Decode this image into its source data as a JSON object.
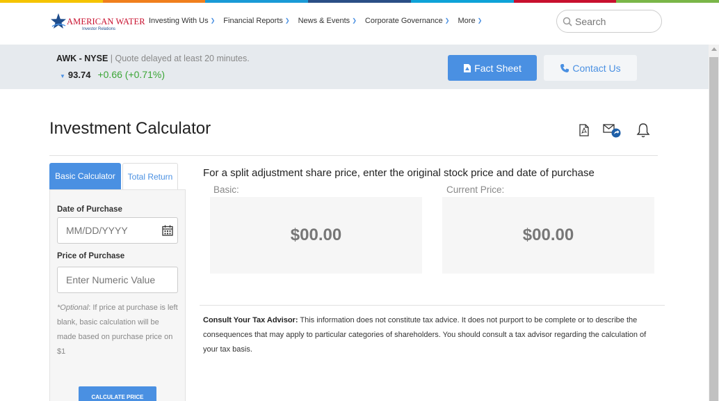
{
  "brand": {
    "name": "AMERICAN WATER",
    "subtitle": "Investor Relations",
    "color_bar": [
      "#f5c400",
      "#f07f1d",
      "#1a9ad6",
      "#2b4f86",
      "#0ea3d8",
      "#c8102e",
      "#7ab648"
    ]
  },
  "nav": {
    "items": [
      {
        "label": "Investing With Us"
      },
      {
        "label": "Financial Reports"
      },
      {
        "label": "News & Events"
      },
      {
        "label": "Corporate Governance"
      },
      {
        "label": "More"
      }
    ],
    "search_placeholder": "Search"
  },
  "quote": {
    "ticker": "AWK - NYSE",
    "delay_text": " | Quote delayed at least 20 minutes.",
    "price": "93.74",
    "change": "+0.66 (+0.71%)",
    "change_color": "#3aa535"
  },
  "actions": {
    "fact_sheet": "Fact Sheet",
    "contact_us": "Contact Us"
  },
  "page": {
    "title": "Investment Calculator",
    "tools": [
      "pdf-icon",
      "email-share-icon",
      "bell-icon"
    ]
  },
  "tabs": [
    {
      "label": "Basic Calculator",
      "active": true
    },
    {
      "label": "Total Return",
      "active": false
    }
  ],
  "form": {
    "date_label": "Date of Purchase",
    "date_placeholder": "MM/DD/YYYY",
    "price_label": "Price of Purchase",
    "price_placeholder": "Enter Numeric Value",
    "note_optional": "*Optional",
    "note_text": ": If price at purchase is left blank, basic calculation will be made based on purchase price on $1",
    "calculate_label": "CALCULATE PRICE"
  },
  "results": {
    "instruction": "For a split adjustment share price, enter the original stock price and date of purchase",
    "basic_label": "Basic:",
    "basic_value": "$00.00",
    "current_label": "Current Price:",
    "current_value": "$00.00"
  },
  "disclaimer": {
    "heading": "Consult Your Tax Advisor:",
    "text": " This information does not constitute tax advice. It does not purport to be complete or to describe the consequences that may apply to particular categories of shareholders. You should consult a tax advisor regarding the calculation of your tax basis."
  },
  "colors": {
    "accent": "#4a90e2",
    "quote_bar_bg": "#e6eaee"
  }
}
